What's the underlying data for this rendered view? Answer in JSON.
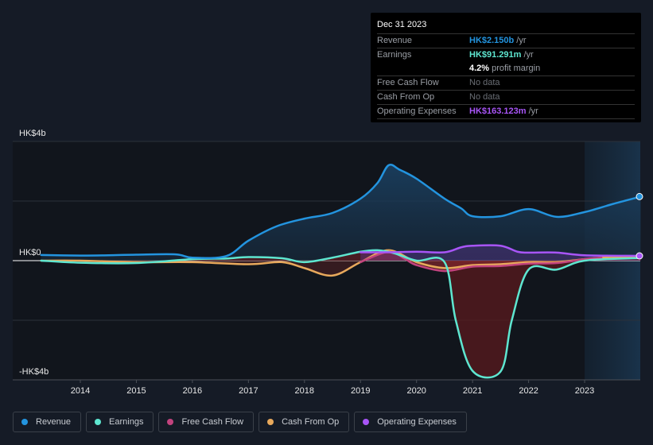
{
  "tooltip": {
    "date": "Dec 31 2023",
    "rows": [
      {
        "label": "Revenue",
        "value": "HK$2.150b",
        "unit": "/yr",
        "color": "#2394df"
      },
      {
        "label": "Earnings",
        "value": "HK$91.291m",
        "unit": "/yr",
        "color": "#5ee6d0"
      },
      {
        "label": "",
        "value": "4.2%",
        "unit": "profit margin",
        "color": "#ffffff"
      },
      {
        "label": "Free Cash Flow",
        "value": "No data",
        "unit": "",
        "color": "#6a6e75"
      },
      {
        "label": "Cash From Op",
        "value": "No data",
        "unit": "",
        "color": "#6a6e75"
      },
      {
        "label": "Operating Expenses",
        "value": "HK$163.123m",
        "unit": "/yr",
        "color": "#a855f7"
      }
    ]
  },
  "legend": [
    {
      "label": "Revenue",
      "color": "#2394df"
    },
    {
      "label": "Earnings",
      "color": "#5ee6d0"
    },
    {
      "label": "Free Cash Flow",
      "color": "#c2437e"
    },
    {
      "label": "Cash From Op",
      "color": "#e8a95c"
    },
    {
      "label": "Operating Expenses",
      "color": "#a855f7"
    }
  ],
  "chart_data": {
    "type": "area",
    "title": "",
    "xlabel": "",
    "ylabel": "",
    "currency_unit": "HK$ billions",
    "x_range": [
      2013.3,
      2024.0
    ],
    "ylim": [
      -4,
      4
    ],
    "y_ticks": [
      {
        "value": 4,
        "label": "HK$4b"
      },
      {
        "value": 0,
        "label": "HK$0"
      },
      {
        "value": -4,
        "label": "-HK$4b"
      }
    ],
    "y_gridlines": [
      4,
      2,
      0,
      -2,
      -4
    ],
    "x_ticks": [
      2014,
      2015,
      2016,
      2017,
      2018,
      2019,
      2020,
      2021,
      2022,
      2023
    ],
    "highlight_range": [
      2023.0,
      2024.0
    ],
    "grid": true,
    "legend_position": "bottom",
    "series": [
      {
        "name": "Revenue",
        "color": "#2394df",
        "fill": true,
        "points": [
          [
            2013.3,
            0.19
          ],
          [
            2014.0,
            0.17
          ],
          [
            2014.5,
            0.18
          ],
          [
            2015.0,
            0.2
          ],
          [
            2015.7,
            0.21
          ],
          [
            2016.0,
            0.1
          ],
          [
            2016.6,
            0.15
          ],
          [
            2017.0,
            0.67
          ],
          [
            2017.5,
            1.15
          ],
          [
            2018.0,
            1.41
          ],
          [
            2018.5,
            1.6
          ],
          [
            2019.0,
            2.08
          ],
          [
            2019.3,
            2.6
          ],
          [
            2019.5,
            3.2
          ],
          [
            2019.7,
            3.05
          ],
          [
            2020.0,
            2.75
          ],
          [
            2020.5,
            2.08
          ],
          [
            2020.8,
            1.75
          ],
          [
            2021.0,
            1.49
          ],
          [
            2021.5,
            1.49
          ],
          [
            2022.0,
            1.73
          ],
          [
            2022.5,
            1.47
          ],
          [
            2023.0,
            1.63
          ],
          [
            2023.5,
            1.9
          ],
          [
            2024.0,
            2.15
          ]
        ]
      },
      {
        "name": "Earnings",
        "color": "#5ee6d0",
        "fill": false,
        "points": [
          [
            2013.3,
            0.0
          ],
          [
            2014.0,
            -0.07
          ],
          [
            2015.0,
            -0.08
          ],
          [
            2016.0,
            0.05
          ],
          [
            2016.6,
            0.07
          ],
          [
            2017.0,
            0.12
          ],
          [
            2017.6,
            0.08
          ],
          [
            2018.0,
            -0.05
          ],
          [
            2018.5,
            0.1
          ],
          [
            2019.0,
            0.3
          ],
          [
            2019.3,
            0.35
          ],
          [
            2019.6,
            0.25
          ],
          [
            2020.0,
            0.0
          ],
          [
            2020.5,
            -0.05
          ],
          [
            2020.7,
            -2.0
          ],
          [
            2021.0,
            -3.7
          ],
          [
            2021.5,
            -3.72
          ],
          [
            2021.7,
            -2.0
          ],
          [
            2022.0,
            -0.3
          ],
          [
            2022.5,
            -0.3
          ],
          [
            2023.0,
            0.0
          ],
          [
            2024.0,
            0.09
          ]
        ]
      },
      {
        "name": "Free Cash Flow",
        "color": "#c2437e",
        "fill": true,
        "points": [
          [
            2019.0,
            -0.05
          ],
          [
            2019.5,
            0.3
          ],
          [
            2019.8,
            0.05
          ],
          [
            2020.0,
            -0.15
          ],
          [
            2020.5,
            -0.35
          ],
          [
            2021.0,
            -0.2
          ],
          [
            2021.5,
            -0.18
          ],
          [
            2022.0,
            -0.1
          ],
          [
            2022.5,
            -0.08
          ],
          [
            2023.0,
            0.05
          ],
          [
            2023.3,
            0.1
          ]
        ]
      },
      {
        "name": "Cash From Op",
        "color": "#e8a95c",
        "fill": true,
        "points": [
          [
            2013.3,
            0.0
          ],
          [
            2014.0,
            0.0
          ],
          [
            2015.0,
            -0.05
          ],
          [
            2016.0,
            -0.05
          ],
          [
            2017.0,
            -0.12
          ],
          [
            2017.6,
            -0.05
          ],
          [
            2018.0,
            -0.25
          ],
          [
            2018.5,
            -0.5
          ],
          [
            2019.0,
            -0.05
          ],
          [
            2019.5,
            0.35
          ],
          [
            2020.0,
            -0.05
          ],
          [
            2020.5,
            -0.25
          ],
          [
            2021.0,
            -0.15
          ],
          [
            2021.5,
            -0.12
          ],
          [
            2022.0,
            -0.05
          ],
          [
            2022.5,
            -0.05
          ],
          [
            2023.0,
            0.05
          ],
          [
            2023.5,
            0.12
          ],
          [
            2024.0,
            0.1
          ]
        ]
      },
      {
        "name": "Operating Expenses",
        "color": "#a855f7",
        "fill": true,
        "points": [
          [
            2019.0,
            0.28
          ],
          [
            2019.5,
            0.28
          ],
          [
            2020.0,
            0.3
          ],
          [
            2020.5,
            0.28
          ],
          [
            2020.8,
            0.45
          ],
          [
            2021.0,
            0.5
          ],
          [
            2021.5,
            0.5
          ],
          [
            2021.8,
            0.3
          ],
          [
            2022.0,
            0.27
          ],
          [
            2022.5,
            0.27
          ],
          [
            2023.0,
            0.18
          ],
          [
            2024.0,
            0.16
          ]
        ]
      }
    ]
  }
}
